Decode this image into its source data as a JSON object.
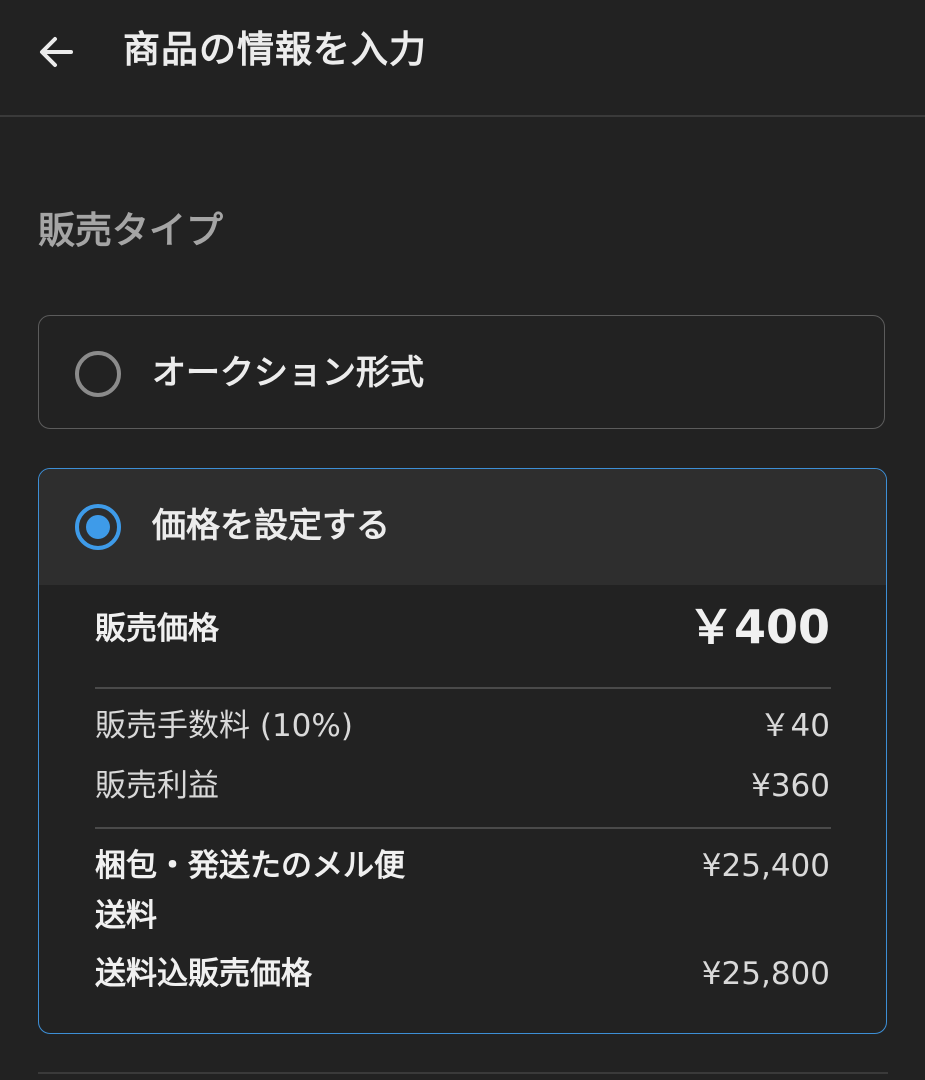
{
  "header": {
    "back_icon": "arrow-left-icon",
    "title": "商品の情報を入力"
  },
  "sales_type": {
    "label": "販売タイプ",
    "options": [
      {
        "label": "オークション形式",
        "selected": false
      },
      {
        "label": "価格を設定する",
        "selected": true
      }
    ]
  },
  "price_details": {
    "sale_price_label": "販売価格",
    "sale_price_value": "￥400",
    "fee_label": "販売手数料 (10%)",
    "fee_value": "￥40",
    "profit_label": "販売利益",
    "profit_value": "¥360",
    "shipping_label": "梱包・発送たのメル便送料",
    "shipping_value": "¥25,400",
    "total_label": "送料込販売価格",
    "total_value": "¥25,800"
  },
  "colors": {
    "background": "#222222",
    "accent": "#3e9be9",
    "text": "#ececec",
    "muted": "#a5a5a5"
  }
}
